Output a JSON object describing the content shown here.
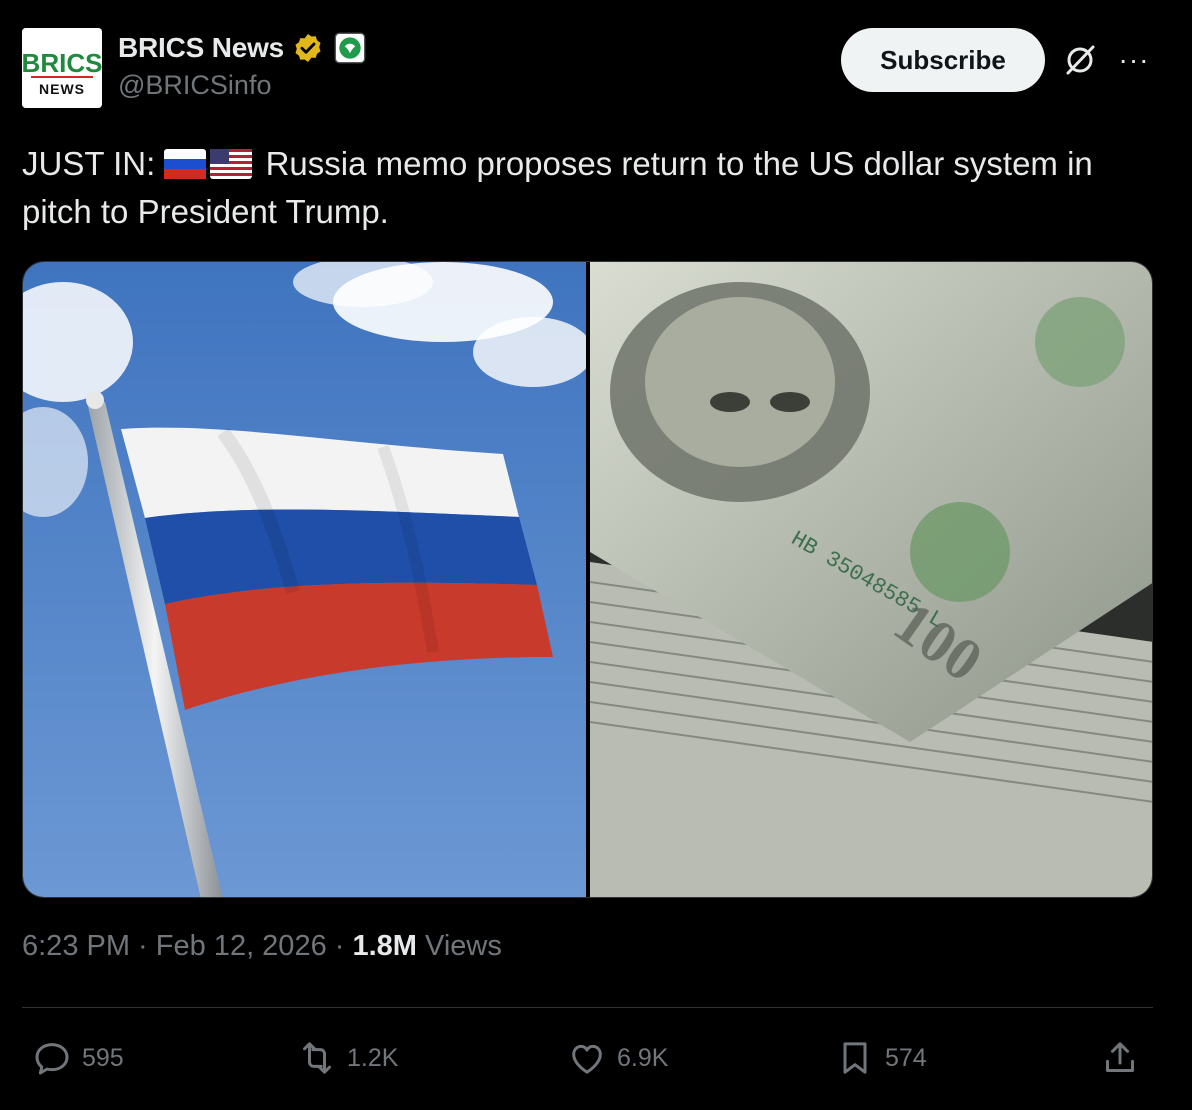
{
  "author": {
    "name": "BRICS News",
    "handle": "@BRICSinfo",
    "avatar_text_top": "BRICS",
    "avatar_text_bottom": "NEWS",
    "verified_color": "#e2b719",
    "affiliate_color": "#1f9b4b"
  },
  "header": {
    "subscribe_label": "Subscribe",
    "grok_icon": "slashed-circle-icon",
    "more_label": "···"
  },
  "tweet": {
    "prefix": "JUST IN:",
    "flags": [
      "russia-flag",
      "us-flag"
    ],
    "body": "Russia memo proposes return to the US dollar system in pitch to President Trump."
  },
  "media": {
    "images": [
      {
        "subject": "russian-flag-photo"
      },
      {
        "subject": "hundred-dollar-bills-photo",
        "serial": "HB 35048585 L"
      }
    ]
  },
  "meta": {
    "time": "6:23 PM",
    "sep1": " · ",
    "date": "Feb 12, 2026",
    "sep2": " · ",
    "views_count": "1.8M",
    "views_label": " Views"
  },
  "actions": {
    "replies": "595",
    "reposts": "1.2K",
    "likes": "6.9K",
    "bookmarks": "574"
  },
  "colors": {
    "background": "#000000",
    "text_primary": "#e7e9ea",
    "text_secondary": "#71767b",
    "divider": "#2f3336"
  }
}
